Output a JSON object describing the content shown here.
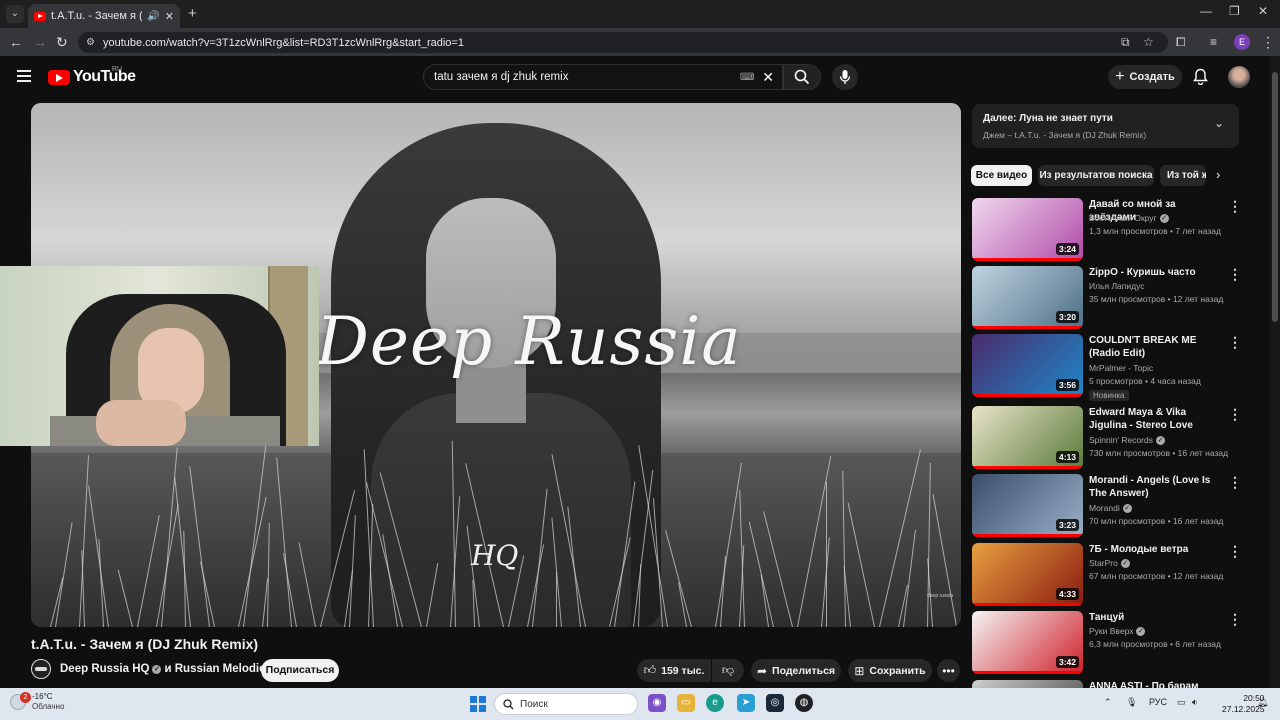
{
  "browser": {
    "tab_title": "t.A.T.u. - Зачем я (DJ Zhuk",
    "url": "youtube.com/watch?v=3T1zcWnlRrg&list=RD3T1zcWnlRrg&start_radio=1",
    "profile_initial": "E"
  },
  "yt": {
    "logo": "YouTube",
    "region": "RU",
    "search_value": "tatu зачем я dj zhuk remix",
    "create_label": "Создать"
  },
  "player": {
    "brand": "Deep Russia",
    "brand_sub": "HQ",
    "watermark": "deep russia"
  },
  "video": {
    "title": "t.A.T.u. - Зачем я (DJ Zhuk Remix)",
    "channel": "Deep Russia HQ",
    "channel_extra": "и Russian Melodies",
    "subscribe": "Подписаться",
    "likes": "159 тыс.",
    "share": "Поделиться",
    "save": "Сохранить"
  },
  "upnext": {
    "title": "Далее: Луна не знает пути",
    "subtitle": "Джем – t.A.T.u. - Зачем я (DJ Zhuk Remix)"
  },
  "chips": [
    "Все видео",
    "Из результатов поиска",
    "Из той же серии"
  ],
  "recs": [
    {
      "title": "Давай со мной за звёздами",
      "channel": "Восточный Округ",
      "verified": true,
      "meta": "1,3 млн просмотров • 7 лет назад",
      "duration": "3:24",
      "badge": "",
      "colors": [
        "#f0d8ee",
        "#b04aa8"
      ]
    },
    {
      "title": "ZippO - Куришь часто",
      "channel": "Илья Лапидус",
      "verified": false,
      "meta": "35 млн просмотров • 12 лет назад",
      "duration": "3:20",
      "badge": "",
      "colors": [
        "#bfd4e0",
        "#4d6e86"
      ]
    },
    {
      "title": "COULDN'T BREAK ME (Radio Edit)",
      "channel": "MrPalmer - Topic",
      "verified": false,
      "meta": "5 просмотров • 4 часа назад",
      "duration": "3:56",
      "badge": "Новинка",
      "colors": [
        "#4a2c6e",
        "#1e88c8"
      ]
    },
    {
      "title": "Edward Maya & Vika Jigulina - Stereo Love (Official Music ...",
      "channel": "Spinnin' Records",
      "verified": true,
      "meta": "730 млн просмотров • 16 лет назад",
      "duration": "4:13",
      "badge": "",
      "colors": [
        "#e8e4c8",
        "#5a7a3a"
      ]
    },
    {
      "title": "Morandi - Angels (Love Is The Answer)",
      "channel": "Morandi",
      "verified": true,
      "meta": "70 млн просмотров • 16 лет назад",
      "duration": "3:23",
      "badge": "",
      "colors": [
        "#3a4e6a",
        "#9ab0c8"
      ]
    },
    {
      "title": "7Б - Молодые ветра",
      "channel": "StarPro",
      "verified": true,
      "meta": "67 млн просмотров • 12 лет назад",
      "duration": "4:33",
      "badge": "",
      "colors": [
        "#e8a040",
        "#8a1a10"
      ]
    },
    {
      "title": "Танцуй",
      "channel": "Руки Вверх",
      "verified": true,
      "meta": "6,3 млн просмотров • 6 лет назад",
      "duration": "3:42",
      "badge": "",
      "colors": [
        "#f4f4f4",
        "#d0202a"
      ]
    },
    {
      "title": "ANNA ASTI - По барам",
      "channel": "",
      "verified": false,
      "meta": "",
      "duration": "",
      "badge": "",
      "colors": [
        "#cfcfcf",
        "#3a3a3a"
      ]
    }
  ],
  "taskbar": {
    "weather_badge": "2",
    "temp": "-16°C",
    "condition": "Облачно",
    "search": "Поиск",
    "lang": "РУС",
    "time": "20:50",
    "date": "27.12.2025"
  }
}
